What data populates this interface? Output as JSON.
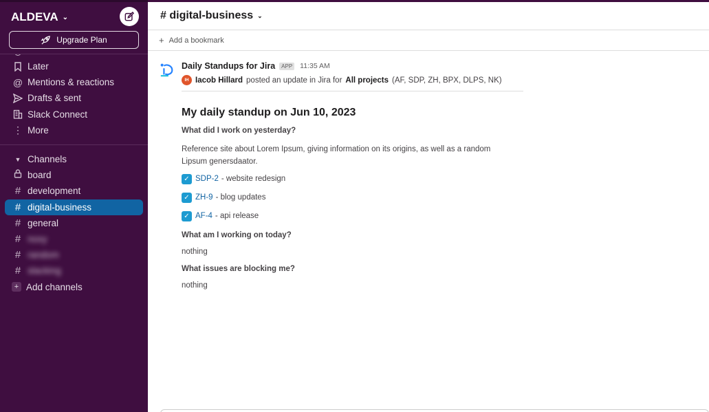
{
  "workspace": {
    "name": "ALDEVA",
    "upgrade_label": "Upgrade Plan"
  },
  "nav": {
    "items": [
      {
        "label": "Later",
        "icon": "bookmark-icon"
      },
      {
        "label": "Mentions & reactions",
        "icon": "at-icon"
      },
      {
        "label": "Drafts & sent",
        "icon": "send-icon"
      },
      {
        "label": "Slack Connect",
        "icon": "building-icon"
      },
      {
        "label": "More",
        "icon": "more-vertical-icon"
      }
    ]
  },
  "channels": {
    "section_label": "Channels",
    "items": [
      {
        "label": "board",
        "icon": "lock-icon"
      },
      {
        "label": "development",
        "icon": "hash-icon"
      },
      {
        "label": "digital-business",
        "icon": "hash-icon",
        "active": true
      },
      {
        "label": "general",
        "icon": "hash-icon"
      },
      {
        "label": "noxy",
        "icon": "hash-icon",
        "blurred": true
      },
      {
        "label": "random",
        "icon": "hash-icon",
        "blurred": true
      },
      {
        "label": "slacking",
        "icon": "hash-icon",
        "blurred": true
      }
    ],
    "add_label": "Add channels"
  },
  "channel": {
    "title": "# digital-business"
  },
  "bookmark": {
    "label": "Add a bookmark"
  },
  "message": {
    "sender": "Daily Standups for Jira",
    "badge": "APP",
    "time": "11:35 AM",
    "poster_initials": "IH",
    "poster": "Iacob Hillard",
    "posted_text": "posted an update in Jira for",
    "projects_bold": "All projects",
    "projects_list": "(AF, SDP, ZH, BPX, DLPS, NK)",
    "standup_title": "My daily standup on Jun 10, 2023",
    "q1": "What did I work on yesterday?",
    "yesterday_text": "Reference site about Lorem Ipsum, giving information on its origins, as well as a random Lipsum genersdaator.",
    "tasks": [
      {
        "key": "SDP-2",
        "desc": "- website redesign"
      },
      {
        "key": "ZH-9",
        "desc": "- blog updates"
      },
      {
        "key": "AF-4",
        "desc": "- api release"
      }
    ],
    "q2": "What am I working on today?",
    "a2": "nothing",
    "q3": "What issues are blocking me?",
    "a3": "nothing"
  },
  "colors": {
    "sidebar": "#3f0e40",
    "active": "#1164a3",
    "link": "#1264a3",
    "checkbox": "#1d9bd1"
  }
}
